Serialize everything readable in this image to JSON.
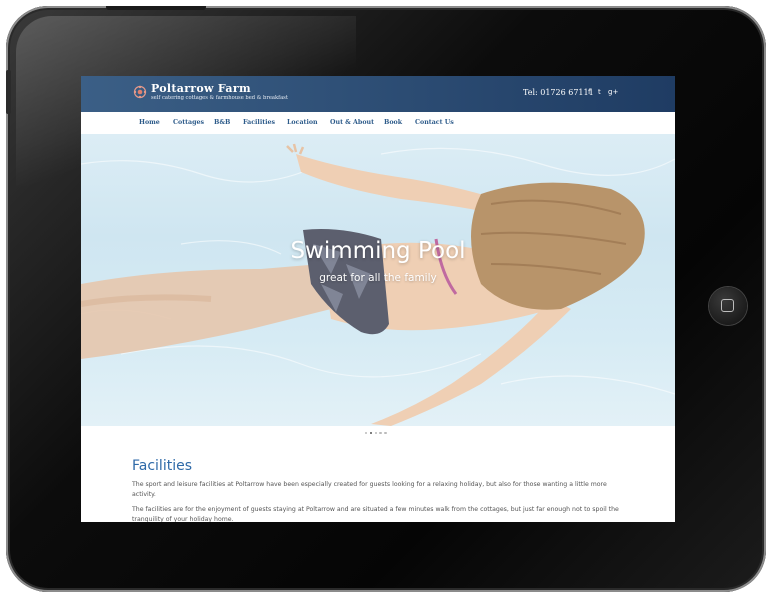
{
  "site": {
    "brand_title": "Poltarrow Farm",
    "brand_subtitle": "self catering cottages & farmhouse bed & breakfast",
    "phone": "Tel: 01726 67111",
    "social": [
      {
        "icon": "facebook-icon",
        "glyph": "f"
      },
      {
        "icon": "twitter-icon",
        "glyph": "t"
      },
      {
        "icon": "google-plus-icon",
        "glyph": "g+"
      }
    ]
  },
  "nav": {
    "items": [
      "Home",
      "Cottages",
      "B&B",
      "Facilities",
      "Location",
      "Out & About",
      "Book",
      "Contact Us"
    ]
  },
  "hero": {
    "title": "Swimming Pool",
    "subtitle": "great for all the family",
    "slide_count": 5,
    "active_slide": 2
  },
  "content": {
    "heading": "Facilities",
    "paragraphs": [
      "The sport and leisure facilities at Poltarrow have been especially created for guests looking for a relaxing holiday, but also for those wanting a little more activity.",
      "The facilities are for the enjoyment of guests staying at Poltarrow and are situated a few minutes walk from the cottages, but just far enough not to spoil the tranquility of your holiday home."
    ]
  },
  "colors": {
    "topbar": "#2a4a73",
    "nav_text": "#2d5b8a",
    "heading": "#2f6aa8",
    "tablet_bezel": "#0a0a0a"
  }
}
